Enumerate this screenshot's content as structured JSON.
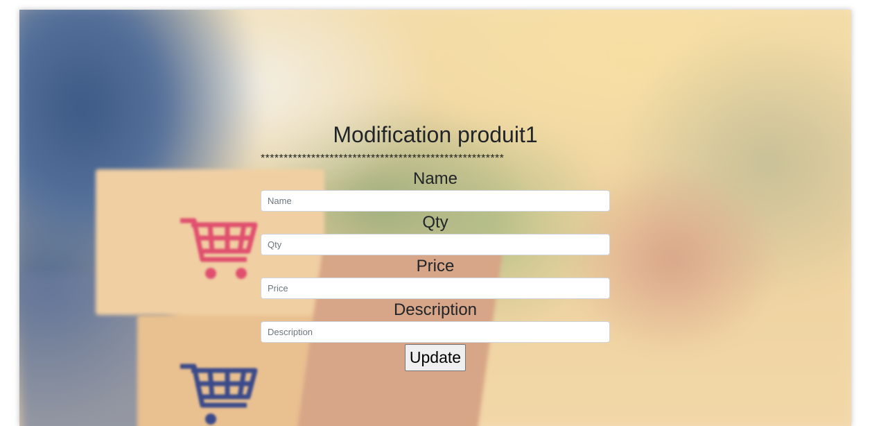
{
  "form": {
    "title": "Modification produit1",
    "separator": "*****************************************************",
    "fields": [
      {
        "label": "Name",
        "placeholder": "Name",
        "value": ""
      },
      {
        "label": "Qty",
        "placeholder": "Qty",
        "value": ""
      },
      {
        "label": "Price",
        "placeholder": "Price",
        "value": ""
      },
      {
        "label": "Description",
        "placeholder": "Description",
        "value": ""
      }
    ],
    "submit_label": "Update"
  },
  "background": {
    "description_icons": [
      "shopping-cart-icon",
      "shopping-cart-icon"
    ],
    "colors": {
      "cart_pink": "#e0506e",
      "cart_blue": "#3a4a8a"
    }
  }
}
